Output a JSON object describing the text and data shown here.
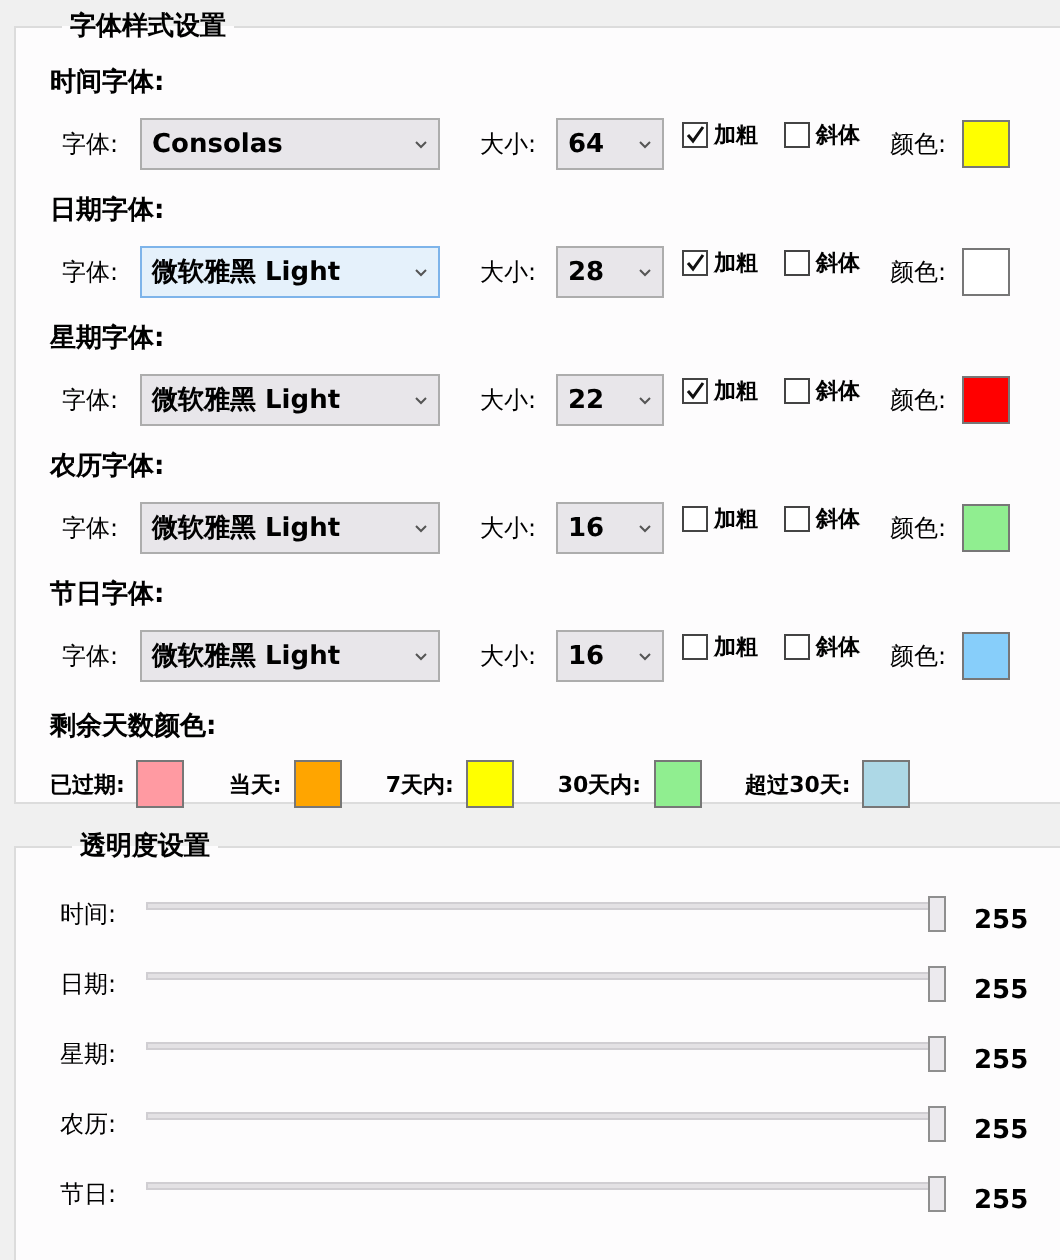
{
  "font_styles": {
    "title": "字体样式设置",
    "groups": [
      {
        "heading": "时间字体:",
        "font_label": "字体:",
        "font": "Consolas",
        "focused": false,
        "size_label": "大小:",
        "size": "64",
        "bold": {
          "label": "加粗",
          "checked": true
        },
        "italic": {
          "label": "斜体",
          "checked": false
        },
        "color_label": "颜色:",
        "color": "#ffff00"
      },
      {
        "heading": "日期字体:",
        "font_label": "字体:",
        "font": "微软雅黑 Light",
        "focused": true,
        "size_label": "大小:",
        "size": "28",
        "bold": {
          "label": "加粗",
          "checked": true
        },
        "italic": {
          "label": "斜体",
          "checked": false
        },
        "color_label": "颜色:",
        "color": "#ffffff"
      },
      {
        "heading": "星期字体:",
        "font_label": "字体:",
        "font": "微软雅黑 Light",
        "focused": false,
        "size_label": "大小:",
        "size": "22",
        "bold": {
          "label": "加粗",
          "checked": true
        },
        "italic": {
          "label": "斜体",
          "checked": false
        },
        "color_label": "颜色:",
        "color": "#ff0000"
      },
      {
        "heading": "农历字体:",
        "font_label": "字体:",
        "font": "微软雅黑 Light",
        "focused": false,
        "size_label": "大小:",
        "size": "16",
        "bold": {
          "label": "加粗",
          "checked": false
        },
        "italic": {
          "label": "斜体",
          "checked": false
        },
        "color_label": "颜色:",
        "color": "#90ee90"
      },
      {
        "heading": "节日字体:",
        "font_label": "字体:",
        "font": "微软雅黑 Light",
        "focused": false,
        "size_label": "大小:",
        "size": "16",
        "bold": {
          "label": "加粗",
          "checked": false
        },
        "italic": {
          "label": "斜体",
          "checked": false
        },
        "color_label": "颜色:",
        "color": "#87cefa"
      }
    ],
    "days_colors": {
      "heading": "剩余天数颜色:",
      "items": [
        {
          "label": "已过期:",
          "color": "#ff9aa2"
        },
        {
          "label": "当天:",
          "color": "#ffa500"
        },
        {
          "label": "7天内:",
          "color": "#ffff00"
        },
        {
          "label": "30天内:",
          "color": "#90ee90"
        },
        {
          "label": "超过30天:",
          "color": "#add8e6"
        }
      ]
    }
  },
  "opacity": {
    "title": "透明度设置",
    "sliders": [
      {
        "label": "时间:",
        "level": 1,
        "value": "255"
      },
      {
        "label": "日期:",
        "level": 1,
        "value": "255"
      },
      {
        "label": "星期:",
        "level": 1,
        "value": "255"
      },
      {
        "label": "农历:",
        "level": 1,
        "value": "255"
      },
      {
        "label": "节日:",
        "level": 1,
        "value": "255"
      }
    ]
  }
}
